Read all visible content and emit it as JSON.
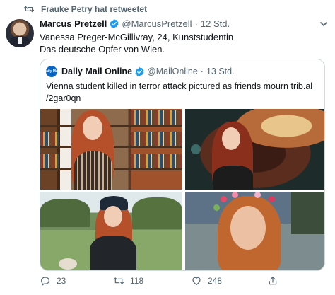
{
  "retweet": {
    "label": "Frauke Petry hat retweetet",
    "icon": "retweet-icon"
  },
  "tweet": {
    "author_name": "Marcus Pretzell",
    "handle": "@MarcusPretzell",
    "separator": "·",
    "time": "12 Std.",
    "text_line1": "Vanessa Preger-McGillivray, 24, Kunststudentin",
    "text_line2": "Das deutsche Opfer von Wien."
  },
  "quote": {
    "logo_text": "Daily Mail",
    "author_name": "Daily Mail Online",
    "handle": "@MailOnline",
    "separator": "·",
    "time": "13 Std.",
    "text_line1": "Vienna student killed in terror attack pictured as friends mourn trib.al",
    "text_line2": "/2gar0qn"
  },
  "actions": {
    "reply_count": "23",
    "retweet_count": "118",
    "like_count": "248"
  },
  "colors": {
    "text": "#0f1419",
    "secondary": "#536471",
    "verified": "#1d9bf0",
    "border": "#cfd9de"
  }
}
